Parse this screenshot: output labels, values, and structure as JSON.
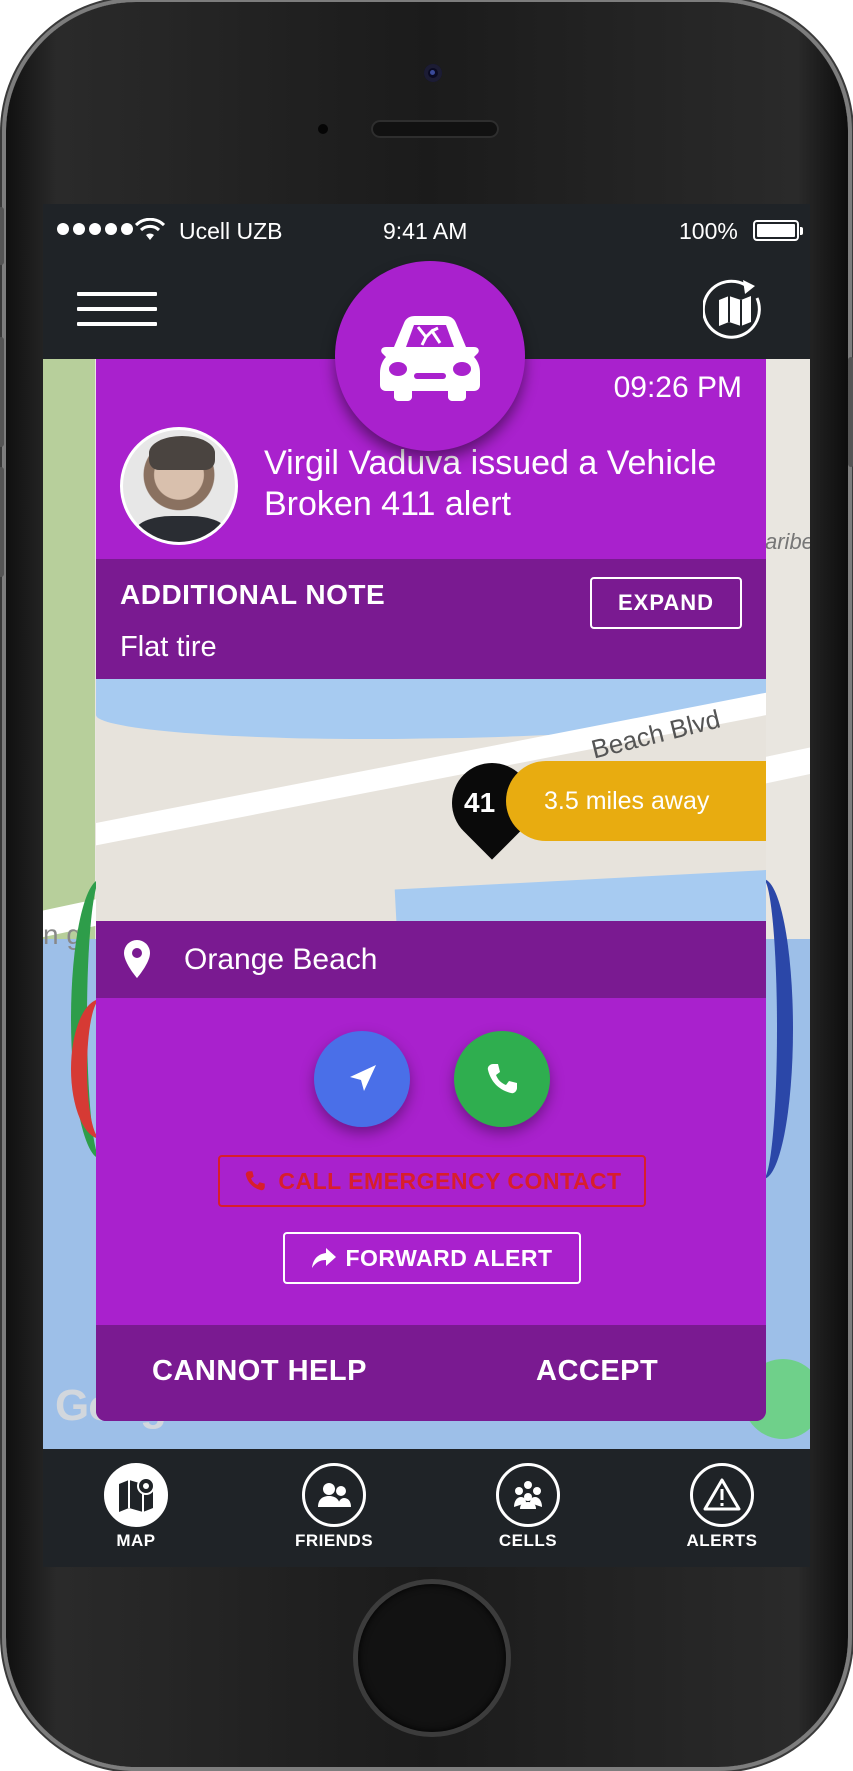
{
  "status_bar": {
    "carrier": "Ucell UZB",
    "time": "9:41 AM",
    "battery": "100%"
  },
  "map_background": {
    "label_fragment_left": "n g",
    "label_fragment_right": "aribe",
    "google_mark": "Google"
  },
  "alert": {
    "timestamp": "09:26 PM",
    "title": "Virgil Vaduva issued a Vehicle Broken 411 alert",
    "note_heading": "ADDITIONAL NOTE",
    "note_text": "Flat tire",
    "expand_label": "EXPAND",
    "map": {
      "road_label": "Beach Blvd",
      "pin_label": "41",
      "distance": "3.5 miles away"
    },
    "location": "Orange Beach",
    "emergency_label": "CALL EMERGENCY CONTACT",
    "forward_label": "FORWARD ALERT",
    "cannot_help_label": "CANNOT HELP",
    "accept_label": "ACCEPT"
  },
  "tabs": [
    {
      "label": "MAP",
      "icon": "map-icon",
      "active": true
    },
    {
      "label": "FRIENDS",
      "icon": "friends-icon",
      "active": false
    },
    {
      "label": "CELLS",
      "icon": "cells-icon",
      "active": false
    },
    {
      "label": "ALERTS",
      "icon": "alerts-icon",
      "active": false
    }
  ],
  "colors": {
    "card_purple": "#a921cd",
    "card_dark_purple": "#7a1a91",
    "distance_amber": "#e8ac10",
    "navigate_blue": "#4a6fe8",
    "call_green": "#2fae4f",
    "emergency_red": "#d81e2c",
    "app_bar_dark": "#1f2327"
  }
}
